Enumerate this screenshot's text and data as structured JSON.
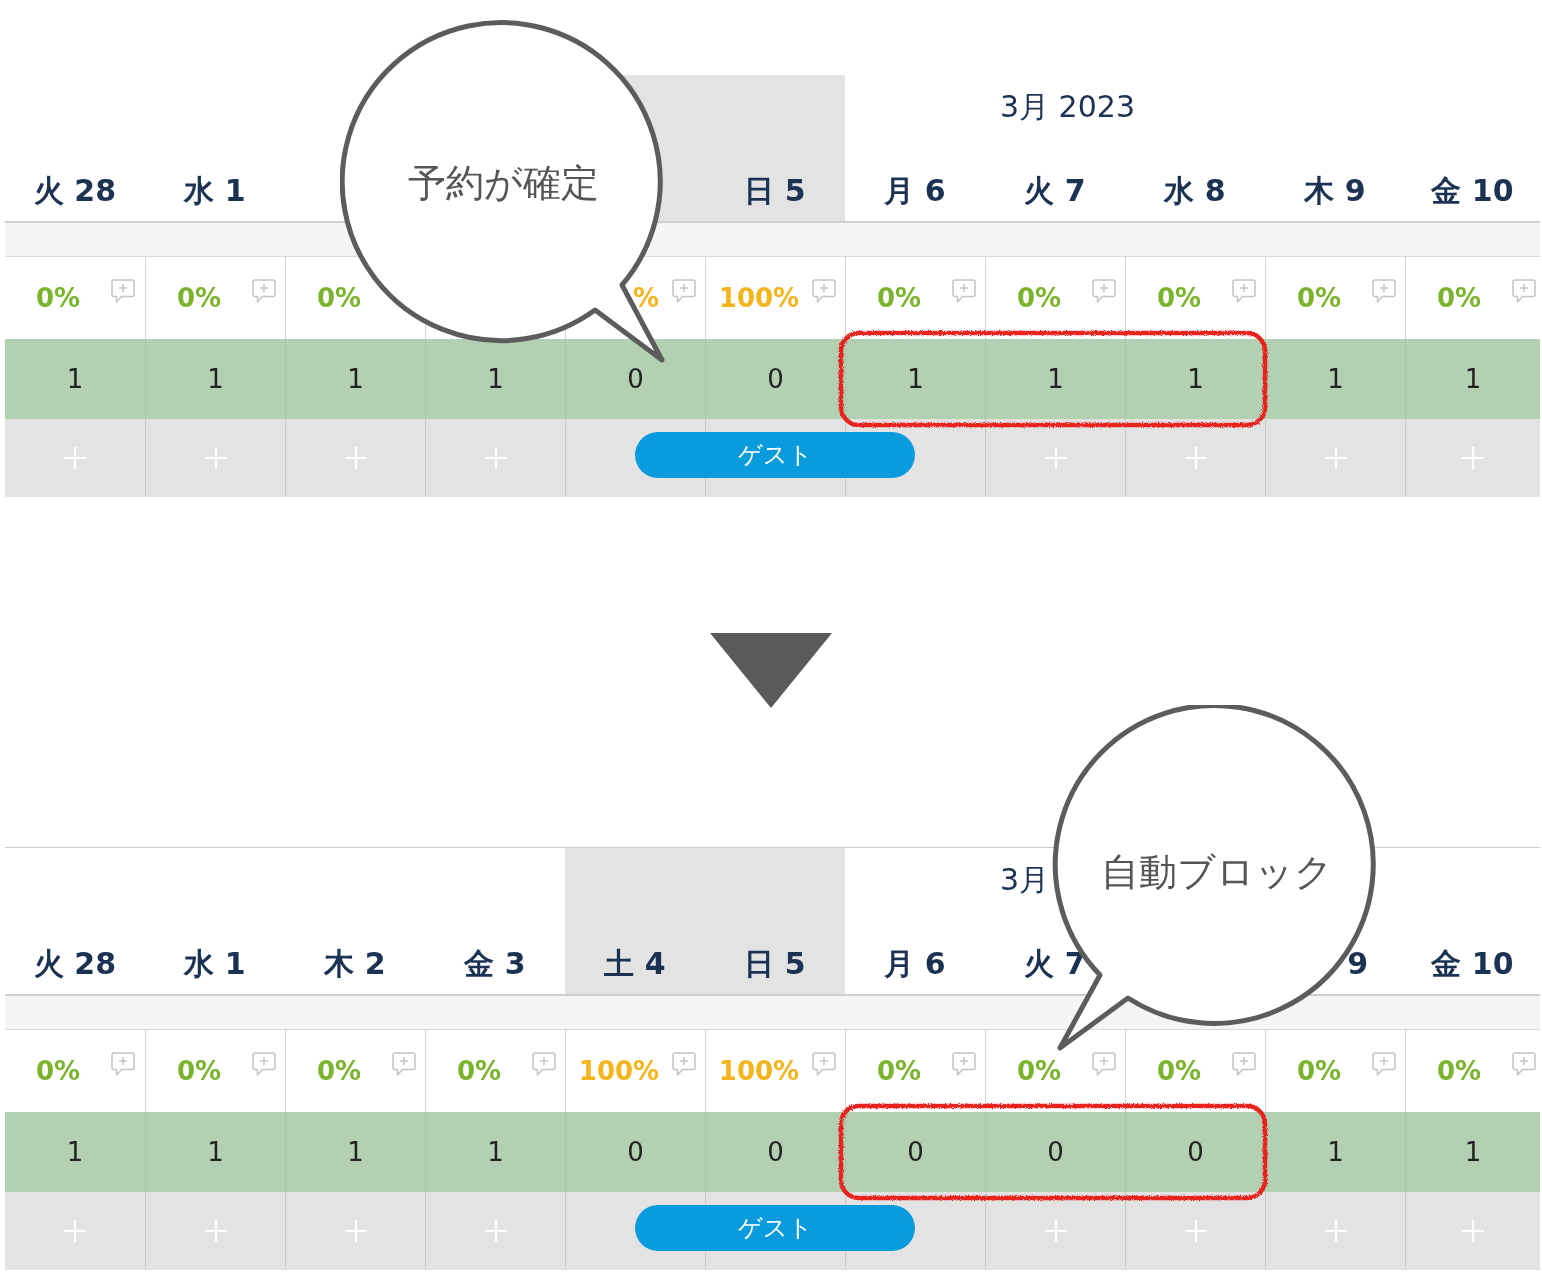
{
  "panels": [
    {
      "top_rule": false,
      "month": "3月 2023",
      "callout": "予約が確定",
      "booking": {
        "label": "ゲスト"
      },
      "days": [
        {
          "label": "火 28",
          "weekend": false,
          "occupancy": "0%",
          "color": "#7ab42d",
          "note": true,
          "count": "1",
          "add": true,
          "booked": false,
          "highlighted": false
        },
        {
          "label": "水 1",
          "weekend": false,
          "occupancy": "0%",
          "color": "#7ab42d",
          "note": true,
          "count": "1",
          "add": true,
          "booked": false,
          "highlighted": false
        },
        {
          "weekend": false,
          "occupancy": "0%",
          "color": "#7ab42d",
          "note": false,
          "count": "1",
          "add": true,
          "booked": false,
          "highlighted": false
        },
        {
          "weekend": false,
          "note": false,
          "count": "1",
          "add": true,
          "booked": false,
          "highlighted": false
        },
        {
          "weekend": true,
          "occupancy_tail": "%",
          "color": "#f4b41c",
          "note": true,
          "count": "0",
          "add": false,
          "booked": true,
          "highlighted": false
        },
        {
          "label": "日 5",
          "weekend": true,
          "occupancy": "100%",
          "color": "#f4b41c",
          "note": true,
          "count": "0",
          "add": false,
          "booked": true,
          "highlighted": false
        },
        {
          "label": "月 6",
          "weekend": false,
          "occupancy": "0%",
          "color": "#7ab42d",
          "note": true,
          "count": "1",
          "add": false,
          "booked": false,
          "highlighted": true
        },
        {
          "label": "火 7",
          "weekend": false,
          "occupancy": "0%",
          "color": "#7ab42d",
          "note": true,
          "count": "1",
          "add": true,
          "booked": false,
          "highlighted": true
        },
        {
          "label": "水 8",
          "weekend": false,
          "occupancy": "0%",
          "color": "#7ab42d",
          "note": true,
          "count": "1",
          "add": true,
          "booked": false,
          "highlighted": true
        },
        {
          "label": "木 9",
          "weekend": false,
          "occupancy": "0%",
          "color": "#7ab42d",
          "note": true,
          "count": "1",
          "add": true,
          "booked": false,
          "highlighted": false
        },
        {
          "label": "金 10",
          "weekend": false,
          "occupancy": "0%",
          "color": "#7ab42d",
          "note": true,
          "count": "1",
          "add": true,
          "booked": false,
          "highlighted": false
        }
      ]
    },
    {
      "top_rule": true,
      "month": "3月",
      "callout": "自動ブロック",
      "booking": {
        "label": "ゲスト"
      },
      "days": [
        {
          "label": "火 28",
          "weekend": false,
          "occupancy": "0%",
          "color": "#7ab42d",
          "note": true,
          "count": "1",
          "add": true,
          "booked": false,
          "highlighted": false
        },
        {
          "label": "水 1",
          "weekend": false,
          "occupancy": "0%",
          "color": "#7ab42d",
          "note": true,
          "count": "1",
          "add": true,
          "booked": false,
          "highlighted": false
        },
        {
          "label": "木 2",
          "weekend": false,
          "occupancy": "0%",
          "color": "#7ab42d",
          "note": true,
          "count": "1",
          "add": true,
          "booked": false,
          "highlighted": false
        },
        {
          "label": "金 3",
          "weekend": false,
          "occupancy": "0%",
          "color": "#7ab42d",
          "note": true,
          "count": "1",
          "add": true,
          "booked": false,
          "highlighted": false
        },
        {
          "label": "土 4",
          "weekend": true,
          "occupancy": "100%",
          "color": "#f4b41c",
          "note": true,
          "count": "0",
          "add": false,
          "booked": true,
          "highlighted": false
        },
        {
          "label": "日 5",
          "weekend": true,
          "occupancy": "100%",
          "color": "#f4b41c",
          "note": true,
          "count": "0",
          "add": false,
          "booked": true,
          "highlighted": false
        },
        {
          "label": "月 6",
          "weekend": false,
          "occupancy": "0%",
          "color": "#7ab42d",
          "note": true,
          "count": "0",
          "add": false,
          "booked": false,
          "highlighted": true
        },
        {
          "label": "火 7",
          "weekend": false,
          "occupancy": "0%",
          "color": "#7ab42d",
          "note": true,
          "count": "0",
          "add": true,
          "booked": false,
          "highlighted": true
        },
        {
          "weekend": false,
          "occupancy": "0%",
          "color": "#7ab42d",
          "note": true,
          "count": "0",
          "add": true,
          "booked": false,
          "highlighted": true
        },
        {
          "label_tail": "9",
          "weekend": false,
          "occupancy": "0%",
          "color": "#7ab42d",
          "note": true,
          "count": "1",
          "add": true,
          "booked": false,
          "highlighted": false
        },
        {
          "label": "金 10",
          "weekend": false,
          "occupancy": "0%",
          "color": "#7ab42d",
          "note": true,
          "count": "1",
          "add": true,
          "booked": false,
          "highlighted": false
        }
      ]
    }
  ]
}
